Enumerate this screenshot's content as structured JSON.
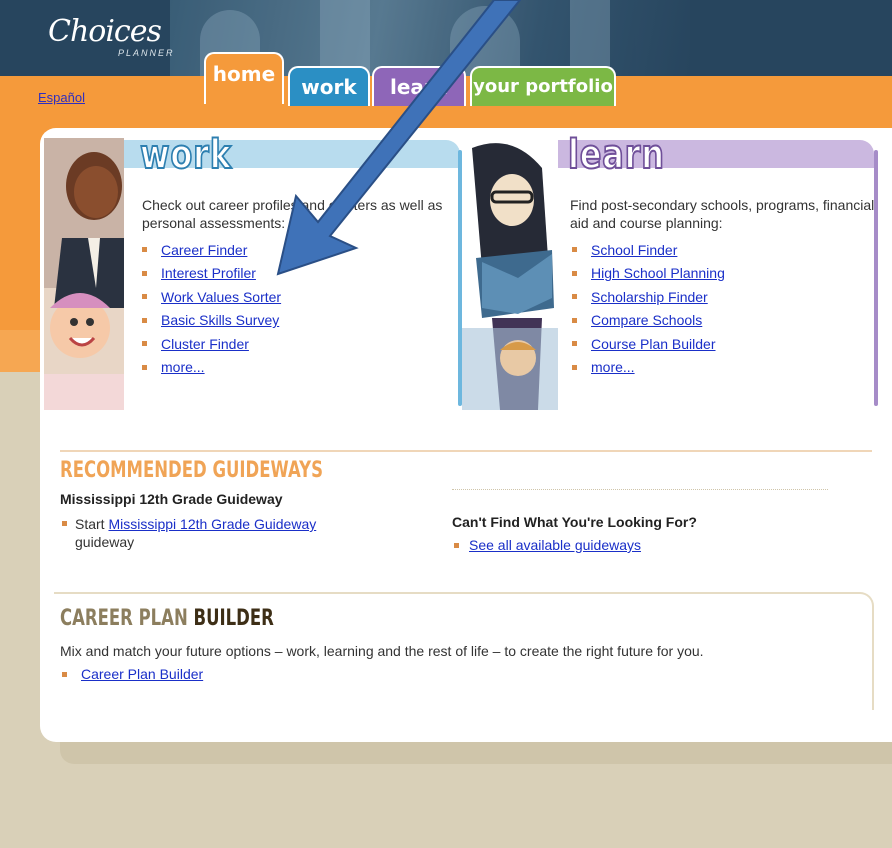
{
  "header": {
    "logo_text": "Choices",
    "logo_sub": "PLANNER",
    "language_link": "Español"
  },
  "tabs": [
    {
      "label": "home"
    },
    {
      "label": "work"
    },
    {
      "label": "learn"
    },
    {
      "label": "your portfolio"
    }
  ],
  "work": {
    "title": "work",
    "description": "Check out career profiles and clusters as well as personal assessments:",
    "links": [
      "Career Finder",
      "Interest Profiler",
      "Work Values Sorter",
      "Basic Skills Survey",
      "Cluster Finder",
      "more..."
    ]
  },
  "learn": {
    "title": "learn",
    "description": "Find post-secondary schools, programs, financial aid and course planning:",
    "links": [
      "School Finder",
      "High School Planning",
      "Scholarship Finder",
      "Compare Schools",
      "Course Plan Builder",
      "more..."
    ]
  },
  "guideways": {
    "title": "RECOMMENDED GUIDEWAYS",
    "subtitle": "Mississippi 12th Grade Guideway",
    "item_prefix": "Start",
    "item_link": "Mississippi 12th Grade Guideway",
    "item_suffix": "guideway",
    "cant_find": "Can't Find What You're Looking For?",
    "see_all": "See all available guideways"
  },
  "career_plan_builder": {
    "title_light": "CAREER PLAN",
    "title_bold": "BUILDER",
    "description": "Mix and match your future options – work, learning and the rest of life – to create the right future for you.",
    "link": "Career Plan Builder"
  },
  "colors": {
    "header": "#27455e",
    "orange": "#f59a3b",
    "work_blue": "#2b8fc4",
    "learn_purple": "#8e66b8",
    "portfolio_green": "#7cb845",
    "link": "#1a2fc8",
    "arrow": "#3f72b8"
  }
}
